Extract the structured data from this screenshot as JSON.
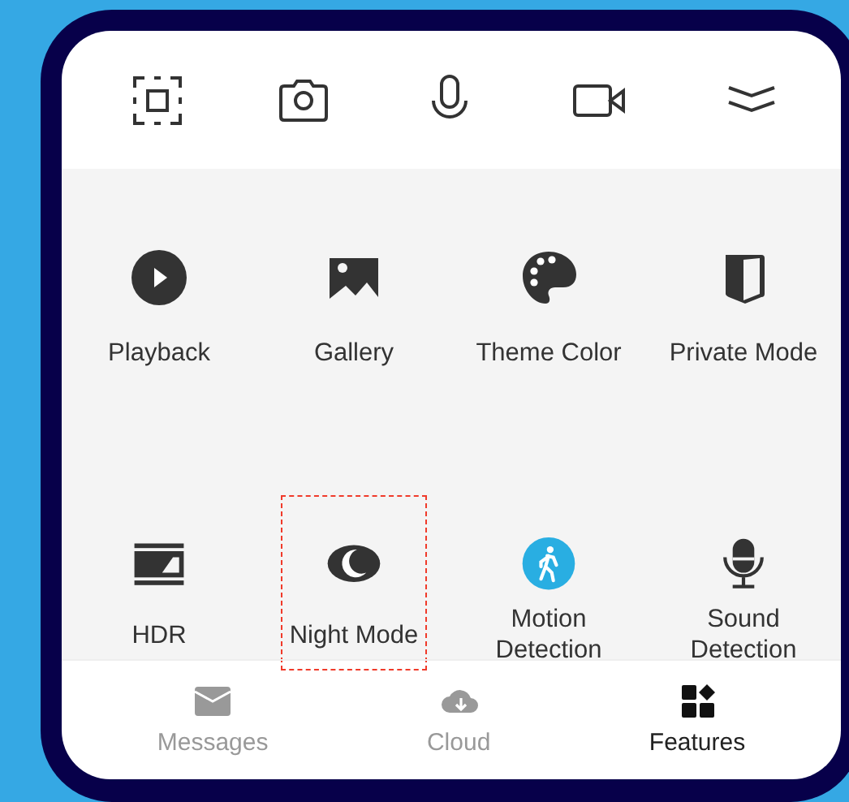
{
  "toolbar": [
    {
      "kind": "scan"
    },
    {
      "kind": "camera"
    },
    {
      "kind": "mic"
    },
    {
      "kind": "video"
    },
    {
      "kind": "collapse"
    }
  ],
  "features": [
    {
      "label": "Playback",
      "kind": "playback",
      "highlighted": false,
      "active": false
    },
    {
      "label": "Gallery",
      "kind": "gallery",
      "highlighted": false,
      "active": false
    },
    {
      "label": "Theme Color",
      "kind": "palette",
      "highlighted": false,
      "active": false
    },
    {
      "label": "Private Mode",
      "kind": "private",
      "highlighted": false,
      "active": false
    },
    {
      "label": "HDR",
      "kind": "hdr",
      "highlighted": false,
      "active": false
    },
    {
      "label": "Night Mode",
      "kind": "night",
      "highlighted": true,
      "active": false
    },
    {
      "label": "Motion Detection",
      "kind": "motion",
      "highlighted": false,
      "active": true
    },
    {
      "label": "Sound Detection",
      "kind": "sound",
      "highlighted": false,
      "active": false
    }
  ],
  "tabs": [
    {
      "label": "Messages",
      "kind": "messages",
      "selected": false
    },
    {
      "label": "Cloud",
      "kind": "cloud",
      "selected": false
    },
    {
      "label": "Features",
      "kind": "features",
      "selected": true
    }
  ]
}
